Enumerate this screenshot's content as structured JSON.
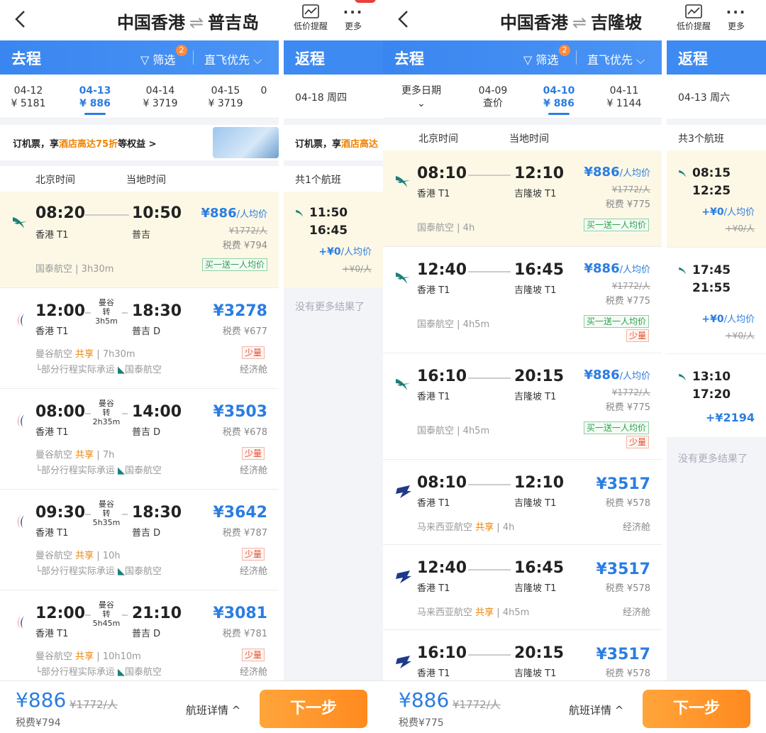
{
  "left": {
    "title_from": "中国香港",
    "title_sep": "⇌",
    "title_to": "普吉岛",
    "low_price_alert": "低价提醒",
    "more": "更多",
    "outbound": "去程",
    "filter": "筛选",
    "filter_count": "2",
    "direct_first": "直飞优先",
    "return": "返程",
    "dates": [
      {
        "date": "04-12",
        "price": "¥ 5181"
      },
      {
        "date": "04-13",
        "price": "¥ 886"
      },
      {
        "date": "04-14",
        "price": "¥ 3719"
      },
      {
        "date": "04-15",
        "price": "¥ 3719"
      },
      {
        "date": "0",
        "price": ""
      }
    ],
    "return_date": "04-18 周四",
    "promo_pre": "订机票，享",
    "promo_hl": "酒店高达75折",
    "promo_post": "等权益 >",
    "rpromo_pre": "订机票，享",
    "rpromo_hl": "酒店高达",
    "beijing_time": "北京时间",
    "local_time": "当地时间",
    "return_count": "共1个航班",
    "flights": [
      {
        "dep": "08:20",
        "arr": "10:50",
        "dep_ap": "香港 T1",
        "arr_ap": "普吉",
        "price": "¥886",
        "per": "/人均价",
        "strike": "¥1772/人",
        "tax": "税费 ¥794",
        "airline": "国泰航空",
        "share": "",
        "duration": "3h30m",
        "tag": "买一送一人均价"
      },
      {
        "dep": "12:00",
        "arr": "18:30",
        "via1": "曼谷",
        "via2": "转",
        "via_dur": "3h5m",
        "dep_ap": "香港 T1",
        "arr_ap": "普吉 D",
        "price": "¥3278",
        "tax": "税费 ¥677",
        "airline": "曼谷航空",
        "share": "共享",
        "duration": "7h30m",
        "few": "少量",
        "sub": "└部分行程实际承运",
        "sub_air": "国泰航空",
        "cls": "经济舱"
      },
      {
        "dep": "08:00",
        "arr": "14:00",
        "via1": "曼谷",
        "via2": "转",
        "via_dur": "2h35m",
        "dep_ap": "香港 T1",
        "arr_ap": "普吉 D",
        "price": "¥3503",
        "tax": "税费 ¥678",
        "airline": "曼谷航空",
        "share": "共享",
        "duration": "7h",
        "few": "少量",
        "sub": "└部分行程实际承运",
        "sub_air": "国泰航空",
        "cls": "经济舱"
      },
      {
        "dep": "09:30",
        "arr": "18:30",
        "via1": "曼谷",
        "via2": "转",
        "via_dur": "5h35m",
        "dep_ap": "香港 T1",
        "arr_ap": "普吉 D",
        "price": "¥3642",
        "tax": "税费 ¥787",
        "airline": "曼谷航空",
        "share": "共享",
        "duration": "10h",
        "few": "少量",
        "sub": "└部分行程实际承运",
        "sub_air": "国泰航空",
        "cls": "经济舱"
      },
      {
        "dep": "12:00",
        "arr": "21:10",
        "via1": "曼谷",
        "via2": "转",
        "via_dur": "5h45m",
        "dep_ap": "香港 T1",
        "arr_ap": "普吉 D",
        "price": "¥3081",
        "tax": "税费 ¥781",
        "airline": "曼谷航空",
        "share": "共享",
        "duration": "10h10m",
        "few": "少量",
        "sub": "└部分行程实际承运",
        "sub_air": "国泰航空",
        "cls": "经济舱"
      }
    ],
    "ret_flights": [
      {
        "dep": "11:50",
        "arr": "16:45",
        "price": "+¥0",
        "per": "/人均价",
        "strike": "+¥0/人"
      }
    ],
    "no_more": "没有更多结果了",
    "footer_price": "¥886",
    "footer_strike": "¥1772/人",
    "footer_tax": "税费¥794",
    "details": "航班详情 ^",
    "next": "下一步"
  },
  "right": {
    "title_from": "中国香港",
    "title_sep": "⇌",
    "title_to": "吉隆坡",
    "low_price_alert": "低价提醒",
    "more": "更多",
    "outbound": "去程",
    "filter": "筛选",
    "filter_count": "2",
    "direct_first": "直飞优先",
    "return": "返程",
    "more_dates": "更多日期",
    "dates": [
      {
        "date": "04-09",
        "price": "查价"
      },
      {
        "date": "04-10",
        "price": "¥ 886"
      },
      {
        "date": "04-11",
        "price": "¥ 1144"
      }
    ],
    "return_date": "04-13 周六",
    "beijing_time": "北京时间",
    "local_time": "当地时间",
    "return_count": "共3个航班",
    "flights": [
      {
        "dep": "08:10",
        "arr": "12:10",
        "dep_ap": "香港 T1",
        "arr_ap": "吉隆坡 T1",
        "price": "¥886",
        "per": "/人均价",
        "strike": "¥1772/人",
        "tax": "税费 ¥775",
        "airline": "国泰航空",
        "share": "",
        "duration": "4h",
        "tag": "买一送一人均价"
      },
      {
        "dep": "12:40",
        "arr": "16:45",
        "dep_ap": "香港 T1",
        "arr_ap": "吉隆坡 T1",
        "price": "¥886",
        "per": "/人均价",
        "strike": "¥1772/人",
        "tax": "税费 ¥775",
        "airline": "国泰航空",
        "share": "",
        "duration": "4h5m",
        "tag": "买一送一人均价",
        "few": "少量"
      },
      {
        "dep": "16:10",
        "arr": "20:15",
        "dep_ap": "香港 T1",
        "arr_ap": "吉隆坡 T1",
        "price": "¥886",
        "per": "/人均价",
        "strike": "¥1772/人",
        "tax": "税费 ¥775",
        "airline": "国泰航空",
        "share": "",
        "duration": "4h5m",
        "tag": "买一送一人均价",
        "few": "少量"
      },
      {
        "dep": "08:10",
        "arr": "12:10",
        "dep_ap": "香港 T1",
        "arr_ap": "吉隆坡 T1",
        "price": "¥3517",
        "tax": "税费 ¥578",
        "airline": "马来西亚航空",
        "share": "共享",
        "duration": "4h",
        "cls": "经济舱"
      },
      {
        "dep": "12:40",
        "arr": "16:45",
        "dep_ap": "香港 T1",
        "arr_ap": "吉隆坡 T1",
        "price": "¥3517",
        "tax": "税费 ¥578",
        "airline": "马来西亚航空",
        "share": "共享",
        "duration": "4h5m",
        "cls": "经济舱"
      },
      {
        "dep": "16:10",
        "arr": "20:15",
        "dep_ap": "香港 T1",
        "arr_ap": "吉隆坡 T1",
        "price": "¥3517",
        "tax": "税费 ¥578"
      }
    ],
    "ret_flights": [
      {
        "dep": "08:15",
        "arr": "12:25",
        "price": "+¥0",
        "per": "/人均价",
        "strike": "+¥0/人"
      },
      {
        "dep": "17:45",
        "arr": "21:55",
        "price": "+¥0",
        "per": "/人均价",
        "strike": "+¥0/人"
      },
      {
        "dep": "13:10",
        "arr": "17:20",
        "price": "+¥2194"
      }
    ],
    "no_more": "没有更多结果了",
    "footer_price": "¥886",
    "footer_strike": "¥1772/人",
    "footer_tax": "税费¥775",
    "details": "航班详情 ^",
    "next": "下一步"
  },
  "colors": {
    "accent": "#2a7de1",
    "header": "#3a86f0",
    "next_button": "#ff9a2e",
    "highlight_row": "#fdf8e6",
    "tag_green": "#2ba24c",
    "share_orange": "#f08300"
  },
  "icons": {
    "back": "chevron-left-icon",
    "alert": "price-chart-icon",
    "more": "ellipsis-icon",
    "filter": "funnel-icon",
    "cathay": "cathay-logo-icon",
    "bangkok": "bangkok-airways-logo-icon",
    "malaysia": "malaysia-airlines-logo-icon"
  }
}
